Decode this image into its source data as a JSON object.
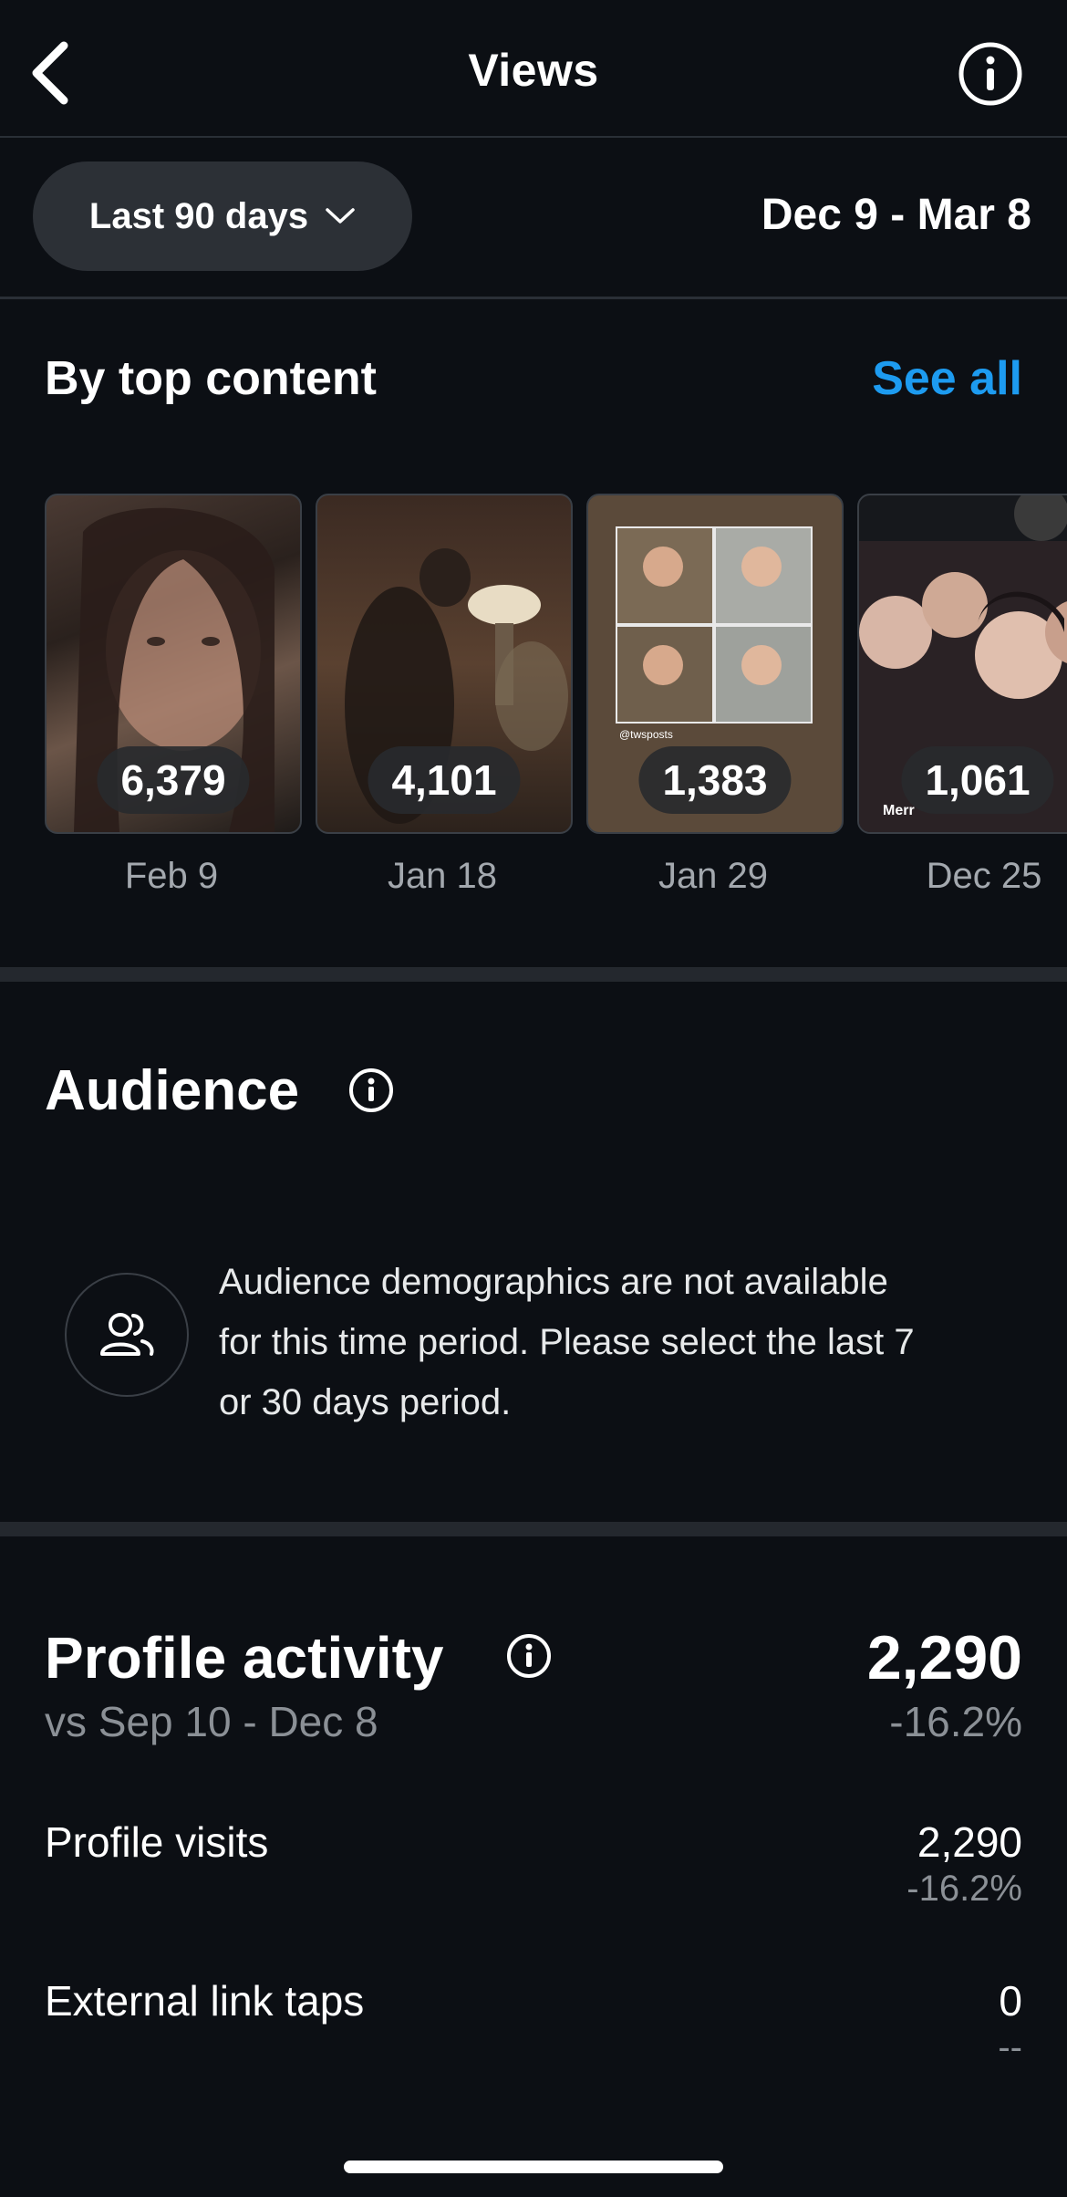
{
  "header": {
    "title": "Views",
    "back_icon": "chevron-left-icon",
    "info_icon": "info-icon"
  },
  "filters": {
    "range_label": "Last 90 days",
    "date_range": "Dec 9 - Mar 8"
  },
  "top_content": {
    "title": "By top content",
    "see_all": "See all",
    "cards": [
      {
        "views": "6,379",
        "date": "Feb 9"
      },
      {
        "views": "4,101",
        "date": "Jan 18"
      },
      {
        "views": "1,383",
        "date": "Jan 29",
        "caption_top": "@twsposts"
      },
      {
        "views": "1,061",
        "date": "Dec 25",
        "caption": "Merr"
      }
    ]
  },
  "audience": {
    "title": "Audience",
    "message": "Audience demographics are not available for this time period. Please select the last 7 or 30 days period."
  },
  "profile_activity": {
    "title": "Profile activity",
    "comparison": "vs Sep 10 - Dec 8",
    "total": "2,290",
    "total_change": "-16.2%",
    "rows": [
      {
        "label": "Profile visits",
        "value": "2,290",
        "change": "-16.2%"
      },
      {
        "label": "External link taps",
        "value": "0",
        "change": "--"
      }
    ]
  },
  "colors": {
    "background": "#0c0f14",
    "accent": "#1d9bf0",
    "pill": "#2c3036",
    "muted": "#8b9096"
  }
}
